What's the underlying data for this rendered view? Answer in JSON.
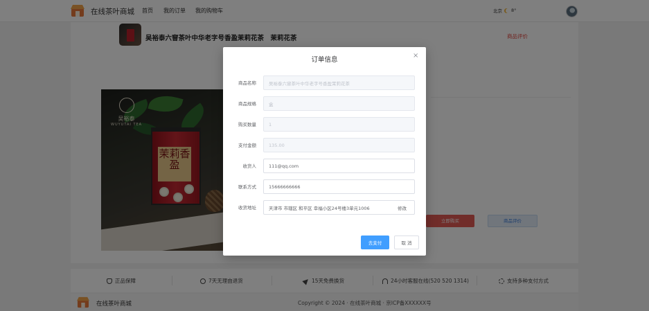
{
  "header": {
    "site_name": "在线茶叶商城",
    "nav": [
      "首页",
      "我的订单",
      "我的购物车"
    ],
    "weather_city": "北京",
    "weather_temp": "8°"
  },
  "product": {
    "title": "吴裕泰六窨茶叶中华老字号香盈茉莉花茶　茉莉花茶",
    "review_link": "商品评价",
    "buy_button": "立即购买",
    "review_button": "商品评价",
    "hero_brand": "吴裕泰",
    "hero_brand_en": "WUYUTAI TEA",
    "tin_text": "茉莉香盈"
  },
  "features": [
    {
      "icon": "shield-icon",
      "label": "正品保障"
    },
    {
      "icon": "clock-icon",
      "label": "7天无理由退货"
    },
    {
      "icon": "send-icon",
      "label": "15天免费换货"
    },
    {
      "icon": "headset-icon",
      "label": "24小时客服在线(520 520 1314)"
    },
    {
      "icon": "sync-icon",
      "label": "支持多种支付方式"
    }
  ],
  "footer": {
    "site_name": "在线茶叶商城",
    "copyright": "Copyright © 2024 · 在线茶叶商城 · 京ICP备XXXXXX号"
  },
  "modal": {
    "title": "订单信息",
    "close": "×",
    "fields": [
      {
        "label": "商品名称",
        "value": "吴裕泰六窨茶叶中华老字号香盈茉莉花茶",
        "disabled": true
      },
      {
        "label": "商品规格",
        "value": "盒",
        "disabled": true
      },
      {
        "label": "购买数量",
        "value": "1",
        "disabled": true
      },
      {
        "label": "支付金额",
        "value": "135.00",
        "disabled": true
      },
      {
        "label": "收货人",
        "value": "111@qq.com",
        "disabled": false
      },
      {
        "label": "联系方式",
        "value": "15666666666",
        "disabled": false
      },
      {
        "label": "收货地址",
        "value": "天津市 市辖区 和平区 幸福小区24号楼3单元1006",
        "disabled": false
      }
    ],
    "modify_label": "修改",
    "pay_button": "去支付",
    "cancel_button": "取 消"
  },
  "colors": {
    "primary": "#409eff",
    "danger": "#e25b55",
    "mask": "rgba(0,0,0,0.5)"
  }
}
